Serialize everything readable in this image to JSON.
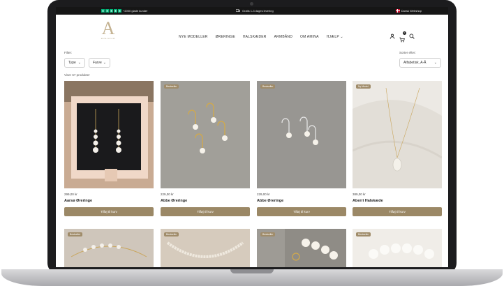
{
  "topbar": {
    "trustpilot": "+2000 glade kunder",
    "shipping": "Gratis 1-3 dages levering",
    "language": "Dansk Webshop"
  },
  "logo": {
    "letter": "A",
    "tagline": "AMINA SMYKKER"
  },
  "nav": [
    "NYE MODELLER",
    "ØRERINGE",
    "HALSKÆDER",
    "ARMBÅND",
    "OM AMINA",
    "HJÆLP"
  ],
  "cart_count": "0",
  "filters": {
    "label": "Filter:",
    "type": "Type",
    "color": "Farve",
    "sort_label": "Sorter efter:",
    "sort_value": "Alfabetisk, A-Å"
  },
  "product_count": "Viser 67 produkter",
  "products": [
    {
      "price": "299,00 kr",
      "name": "Aarsø Øreringe",
      "badge": "",
      "button": "Tilføj til kurv"
    },
    {
      "price": "229,00 kr",
      "name": "Abbe Øreringe",
      "badge": "Bestseller",
      "button": "Tilføj til kurv"
    },
    {
      "price": "229,00 kr",
      "name": "Abbe Øreringe",
      "badge": "Bestseller",
      "button": "Tilføj til kurv"
    },
    {
      "price": "389,00 kr",
      "name": "Aberri Halskæde",
      "badge": "Ny Model",
      "button": "Tilføj til kurv"
    }
  ],
  "row2_badges": [
    "Bestseller",
    "Bestseller",
    "Bestseller",
    "Bestseller"
  ]
}
